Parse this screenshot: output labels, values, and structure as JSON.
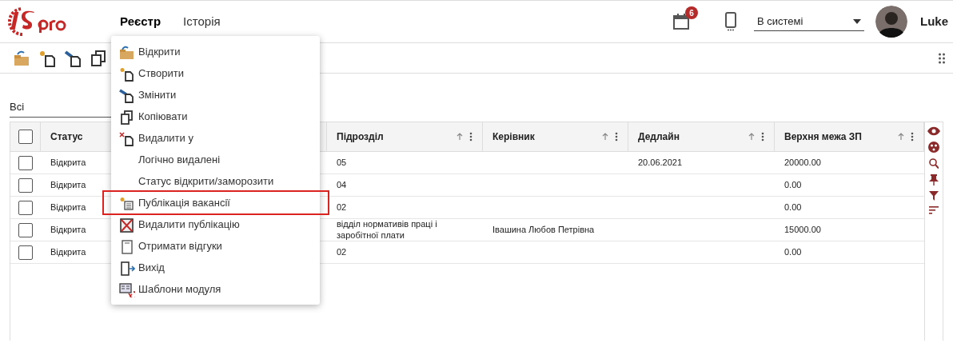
{
  "header": {
    "nav": [
      {
        "label": "Реєстр",
        "selected": true
      },
      {
        "label": "Історія",
        "selected": false
      }
    ],
    "notifications_badge": "6",
    "status_select": {
      "value": "В системі"
    },
    "user_name": "Luke"
  },
  "filter": {
    "value": "Всі"
  },
  "table": {
    "all_checked": false,
    "columns": [
      {
        "label": "Статус",
        "kind": "label-only"
      },
      {
        "kind": "dots-only"
      },
      {
        "label": "Підрозділ",
        "kind": "full"
      },
      {
        "label": "Керівник",
        "kind": "full"
      },
      {
        "label": "Дедлайн",
        "kind": "full"
      },
      {
        "label": "Верхня межа ЗП",
        "kind": "full"
      }
    ],
    "rows": [
      {
        "checked": false,
        "cells": [
          "Відкрита",
          "",
          "05",
          "",
          "20.06.2021",
          "20000.00"
        ]
      },
      {
        "checked": false,
        "cells": [
          "Відкрита",
          "",
          "04",
          "",
          "",
          "0.00"
        ]
      },
      {
        "checked": false,
        "cells": [
          "Відкрита",
          "",
          "02",
          "",
          "",
          "0.00"
        ]
      },
      {
        "checked": false,
        "cells": [
          "Відкрита",
          "",
          "відділ нормативів праці і заробітної плати",
          "Івашина Любов Петрівна",
          "",
          "15000.00"
        ]
      },
      {
        "checked": false,
        "cells": [
          "Відкрита",
          "",
          "02",
          "",
          "",
          "0.00"
        ]
      }
    ]
  },
  "menu": {
    "items": [
      {
        "label": "Відкрити",
        "highlighted": false
      },
      {
        "label": "Створити",
        "highlighted": false
      },
      {
        "label": "Змінити",
        "highlighted": false
      },
      {
        "label": "Копіювати",
        "highlighted": false
      },
      {
        "label": "Видалити у",
        "highlighted": false
      },
      {
        "label": "Логічно видалені",
        "highlighted": false
      },
      {
        "label": "Статус відкрити/заморозити",
        "highlighted": false
      },
      {
        "label": "Публікація вакансії",
        "highlighted": true
      },
      {
        "label": "Видалити публікацію",
        "highlighted": false
      },
      {
        "label": "Отримати відгуки",
        "highlighted": false
      },
      {
        "label": "Вихід",
        "highlighted": false
      },
      {
        "label": "Шаблони модуля",
        "highlighted": false
      }
    ]
  }
}
